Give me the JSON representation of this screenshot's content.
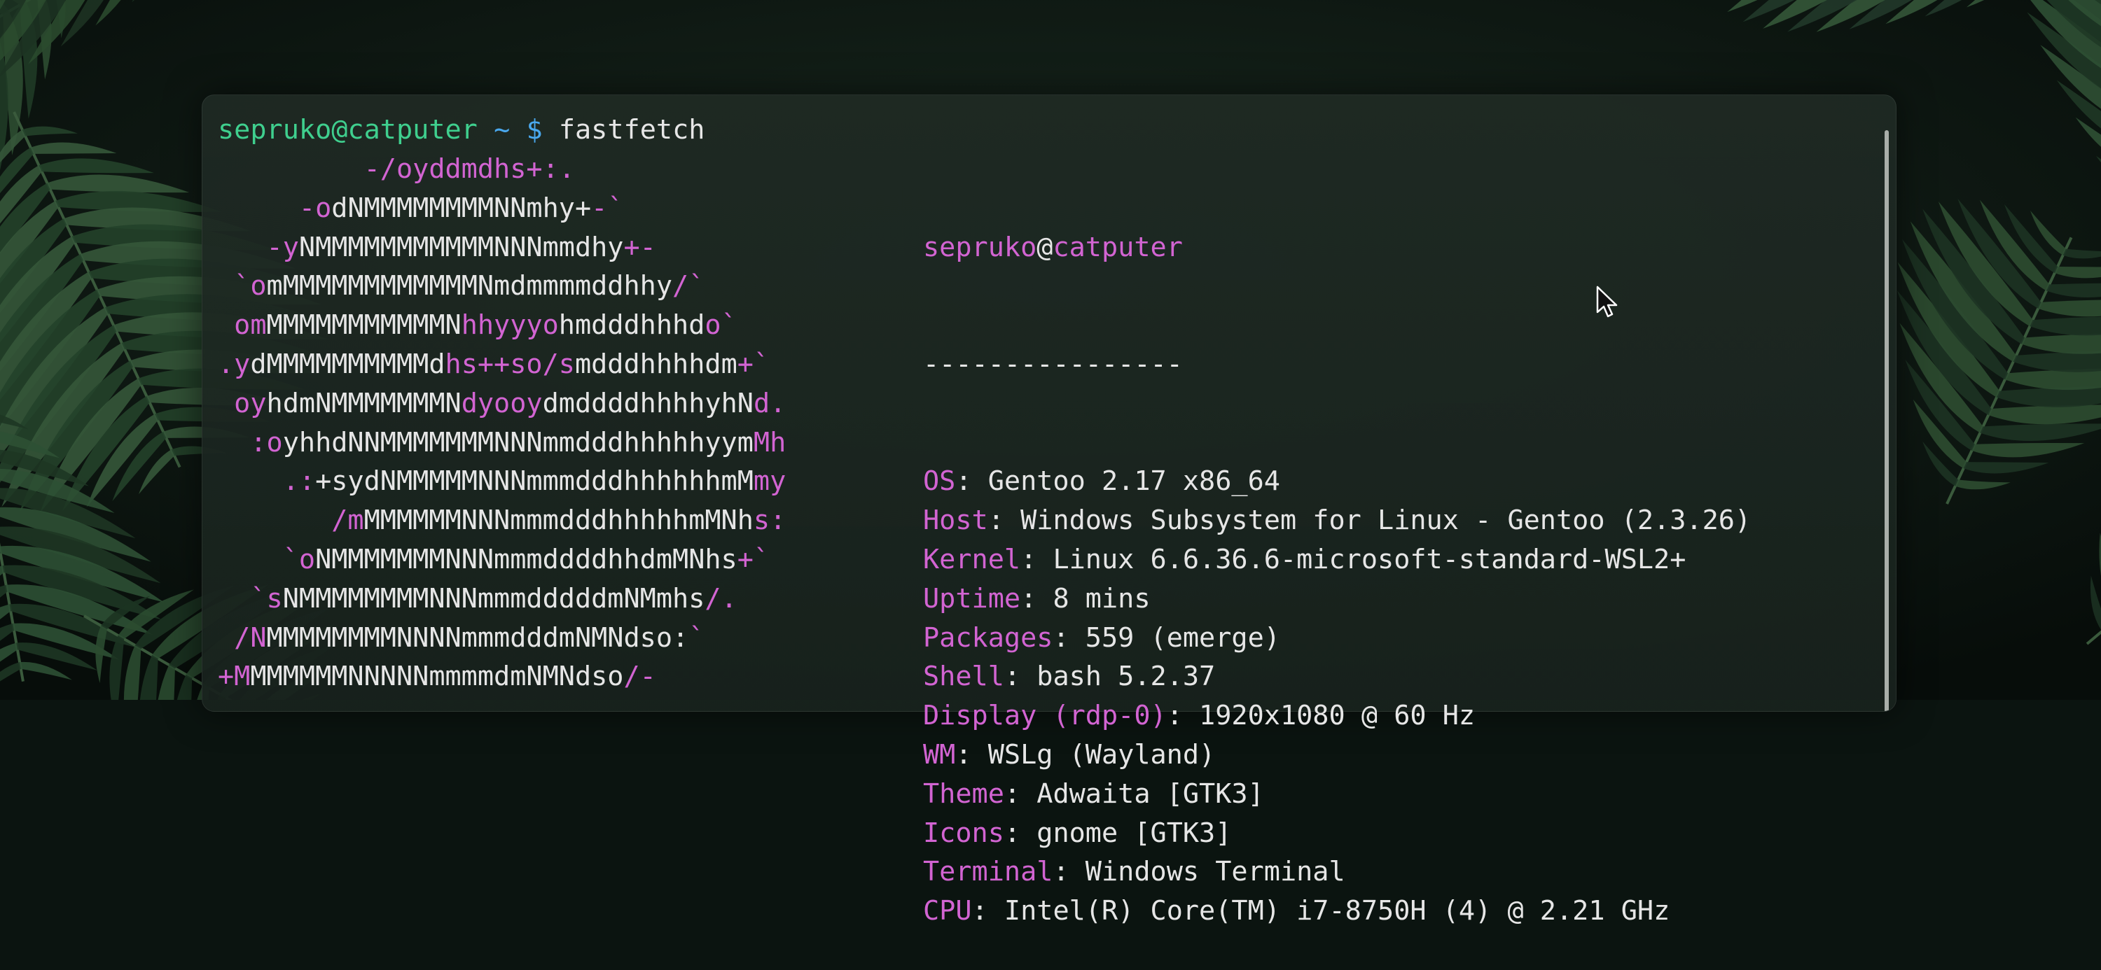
{
  "colors": {
    "user_host": "#3fcf8e",
    "path_prompt": "#4aa8ee",
    "accent": "#d264d2",
    "text": "#e6e6e6"
  },
  "prompt": {
    "user_host": "sepruko@catputer",
    "path": "~",
    "symbol": "$",
    "command": "fastfetch"
  },
  "logo_lines": [
    [
      {
        "t": "         -/oyddmdhs+:.",
        "c": "m"
      }
    ],
    [
      {
        "t": "     -o",
        "c": "m"
      },
      {
        "t": "dNMMMMMMMMNNmhy+",
        "c": "w"
      },
      {
        "t": "-`",
        "c": "m"
      }
    ],
    [
      {
        "t": "   -y",
        "c": "m"
      },
      {
        "t": "NMMMMMMMMMMMNNNmmdhy",
        "c": "w"
      },
      {
        "t": "+-",
        "c": "m"
      }
    ],
    [
      {
        "t": " `o",
        "c": "m"
      },
      {
        "t": "mMMMMMMMMMMMMNmdmmmmddhhy",
        "c": "w"
      },
      {
        "t": "/`",
        "c": "m"
      }
    ],
    [
      {
        "t": " om",
        "c": "m"
      },
      {
        "t": "MMMMMMMMMMMN",
        "c": "w"
      },
      {
        "t": "hhyyyo",
        "c": "m"
      },
      {
        "t": "hmdddhhhd",
        "c": "w"
      },
      {
        "t": "o`",
        "c": "m"
      }
    ],
    [
      {
        "t": ".y",
        "c": "m"
      },
      {
        "t": "dMMMMMMMMMMd",
        "c": "w"
      },
      {
        "t": "hs++so/s",
        "c": "m"
      },
      {
        "t": "mdddhhhhdm",
        "c": "w"
      },
      {
        "t": "+`",
        "c": "m"
      }
    ],
    [
      {
        "t": " oy",
        "c": "m"
      },
      {
        "t": "hdmNMMMMMMMN",
        "c": "w"
      },
      {
        "t": "dyooy",
        "c": "m"
      },
      {
        "t": "dmddddhhhhyhN",
        "c": "w"
      },
      {
        "t": "d.",
        "c": "m"
      }
    ],
    [
      {
        "t": "  :o",
        "c": "m"
      },
      {
        "t": "yhhdNNMMMMMMMNNNmmdddhhhhhyym",
        "c": "w"
      },
      {
        "t": "Mh",
        "c": "m"
      }
    ],
    [
      {
        "t": "    .:",
        "c": "m"
      },
      {
        "t": "+sydNMMMMMNNNmmmdddhhhhhhmM",
        "c": "w"
      },
      {
        "t": "my",
        "c": "m"
      }
    ],
    [
      {
        "t": "       /m",
        "c": "m"
      },
      {
        "t": "MMMMMMNNNmmmdddhhhhhmMNh",
        "c": "w"
      },
      {
        "t": "s:",
        "c": "m"
      }
    ],
    [
      {
        "t": "    `o",
        "c": "m"
      },
      {
        "t": "NMMMMMMMNNNmmmddddhhdmMNhs",
        "c": "w"
      },
      {
        "t": "+`",
        "c": "m"
      }
    ],
    [
      {
        "t": "  `s",
        "c": "m"
      },
      {
        "t": "NMMMMMMMMNNNmmmdddddmNMmhs",
        "c": "w"
      },
      {
        "t": "/.",
        "c": "m"
      }
    ],
    [
      {
        "t": " /N",
        "c": "m"
      },
      {
        "t": "MMMMMMMMNNNNmmmdddmNMNdso:",
        "c": "w"
      },
      {
        "t": "`",
        "c": "m"
      }
    ],
    [
      {
        "t": "+M",
        "c": "m"
      },
      {
        "t": "MMMMMMNNNNNmmmmdmNMNdso",
        "c": "w"
      },
      {
        "t": "/-",
        "c": "m"
      }
    ]
  ],
  "info_header": {
    "user": "sepruko",
    "at": "@",
    "host": "catputer",
    "separator": "----------------"
  },
  "info_lines": [
    {
      "key": "OS",
      "value": "Gentoo 2.17 x86_64"
    },
    {
      "key": "Host",
      "value": "Windows Subsystem for Linux - Gentoo (2.3.26)"
    },
    {
      "key": "Kernel",
      "value": "Linux 6.6.36.6-microsoft-standard-WSL2+"
    },
    {
      "key": "Uptime",
      "value": "8 mins"
    },
    {
      "key": "Packages",
      "value": "559 (emerge)"
    },
    {
      "key": "Shell",
      "value": "bash 5.2.37"
    },
    {
      "key": "Display (rdp-0)",
      "value": "1920x1080 @ 60 Hz"
    },
    {
      "key": "WM",
      "value": "WSLg (Wayland)"
    },
    {
      "key": "Theme",
      "value": "Adwaita [GTK3]"
    },
    {
      "key": "Icons",
      "value": "gnome [GTK3]"
    },
    {
      "key": "Terminal",
      "value": "Windows Terminal"
    },
    {
      "key": "CPU",
      "value": "Intel(R) Core(TM) i7-8750H (4) @ 2.21 GHz"
    }
  ],
  "icons": {
    "cursor": "mouse-pointer-icon",
    "wallpaper": "tropical-leaves-wallpaper"
  }
}
